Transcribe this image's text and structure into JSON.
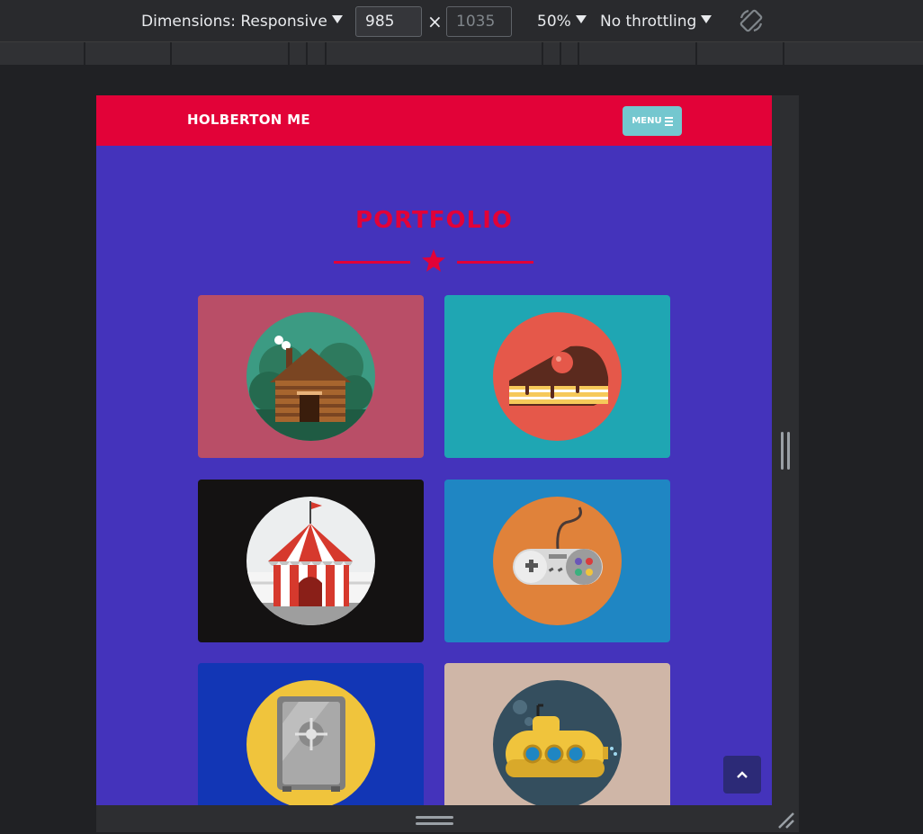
{
  "devtools": {
    "dimensions_label": "Dimensions: Responsive",
    "width_value": "985",
    "height_placeholder": "1035",
    "times_symbol": "×",
    "zoom": "50%",
    "throttling": "No throttling"
  },
  "site": {
    "brand": "HOLBERTON ME",
    "menu_label": "MENU",
    "section_title": "PORTFOLIO",
    "colors": {
      "navbar": "#e20238",
      "page_background": "#4433bb",
      "menu_button": "#74c7cf",
      "accent": "#e20238"
    },
    "portfolio_items": [
      {
        "subject": "cabin",
        "tile_color": "#b94e67",
        "circle_color": "#3c9b83"
      },
      {
        "subject": "cake",
        "tile_color": "#1fa6b3",
        "circle_color": "#e5584a"
      },
      {
        "subject": "circus",
        "tile_color": "#141212",
        "circle_color": "#eceeef"
      },
      {
        "subject": "game-controller",
        "tile_color": "#1f86c3",
        "circle_color": "#e0823a"
      },
      {
        "subject": "safe",
        "tile_color": "#1236b5",
        "circle_color": "#f0c43c"
      },
      {
        "subject": "submarine",
        "tile_color": "#cfb6a7",
        "circle_color": "#344e5e"
      }
    ],
    "back_to_top_icon": "chevron-up-icon"
  }
}
